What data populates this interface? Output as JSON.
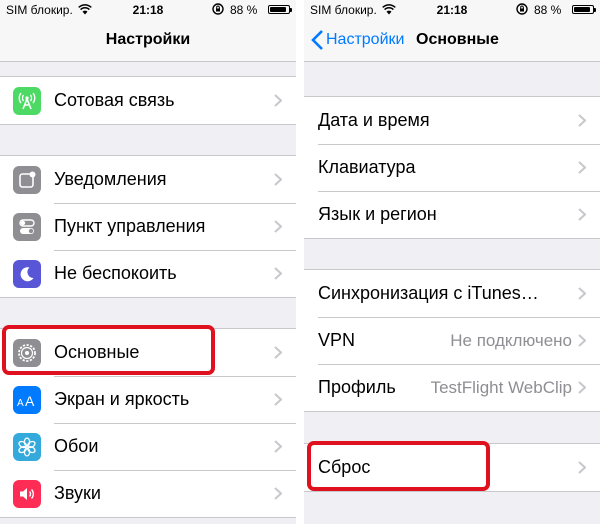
{
  "left": {
    "status": {
      "carrier": "SIM блокир.",
      "time": "21:18",
      "battery": "88 %",
      "battery_level": 0.88
    },
    "nav": {
      "title": "Настройки"
    },
    "groups": [
      [
        {
          "label": "Сотовая связь",
          "icon": "antenna-icon",
          "color": "#4cd964"
        }
      ],
      [
        {
          "label": "Уведомления",
          "icon": "notifications-icon",
          "color": "#8e8e93"
        },
        {
          "label": "Пункт управления",
          "icon": "toggles-icon",
          "color": "#8e8e93"
        },
        {
          "label": "Не беспокоить",
          "icon": "moon-icon",
          "color": "#5856d6"
        }
      ],
      [
        {
          "label": "Основные",
          "icon": "gear-icon",
          "color": "#8e8e93"
        },
        {
          "label": "Экран и яркость",
          "icon": "text-size-icon",
          "color": "#007aff"
        },
        {
          "label": "Обои",
          "icon": "flower-icon",
          "color": "#34aadc"
        },
        {
          "label": "Звуки",
          "icon": "speaker-icon",
          "color": "#ff2d55"
        }
      ]
    ]
  },
  "right": {
    "status": {
      "carrier": "SIM блокир.",
      "time": "21:18",
      "battery": "88 %",
      "battery_level": 0.88
    },
    "nav": {
      "back": "Настройки",
      "title": "Основные"
    },
    "groups": [
      [
        {
          "label": "Дата и время"
        },
        {
          "label": "Клавиатура"
        },
        {
          "label": "Язык и регион"
        }
      ],
      [
        {
          "label": "Синхронизация с iTunes…"
        },
        {
          "label": "VPN",
          "value": "Не подключено"
        },
        {
          "label": "Профиль",
          "value": "TestFlight WebClip"
        }
      ],
      [
        {
          "label": "Сброс"
        }
      ]
    ]
  },
  "colors": {
    "accent": "#007aff",
    "highlight": "#e0111e",
    "separator": "#c8c7cc",
    "background": "#efeff4"
  }
}
